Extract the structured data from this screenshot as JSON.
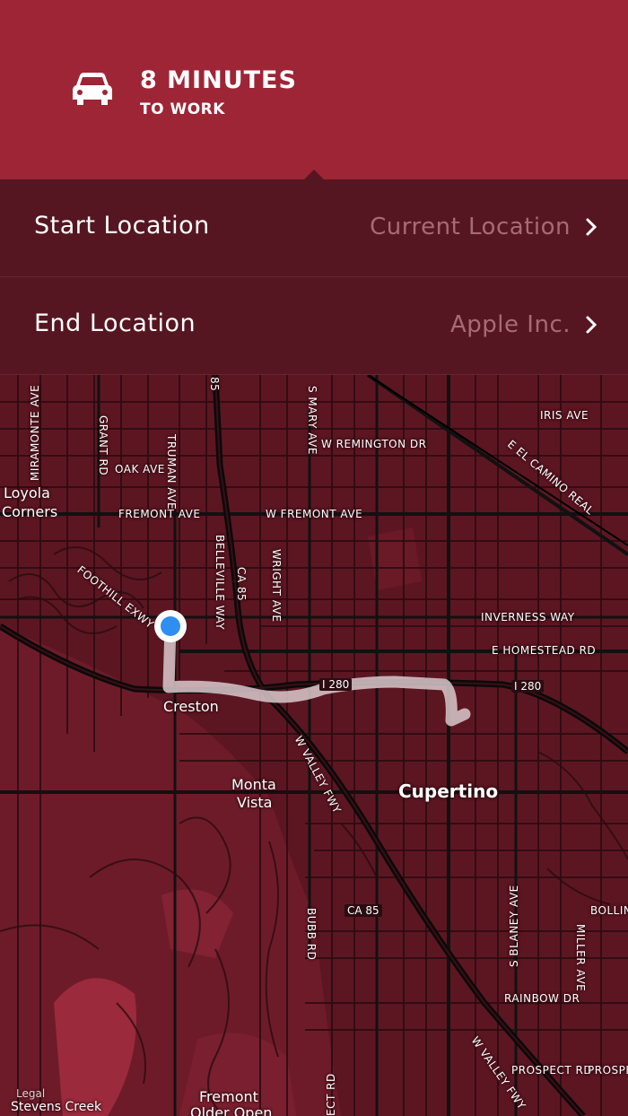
{
  "header": {
    "eta": "8 MINUTES",
    "subtitle": "TO WORK"
  },
  "rows": [
    {
      "label": "Start Location",
      "value": "Current Location"
    },
    {
      "label": "End Location",
      "value": "Apple Inc."
    }
  ],
  "map": {
    "labels": {
      "iris": "IRIS AVE",
      "remington": "W REMINGTON DR",
      "oak": "OAK AVE",
      "fremont": "FREMONT AVE",
      "wfremont": "W FREMONT AVE",
      "inverness": "INVERNESS WAY",
      "homestead": "E HOMESTEAD RD",
      "rainbow": "RAINBOW DR",
      "prospect": "PROSPECT RD",
      "prospect2": "PROSPE",
      "bollin": "BOLLIN",
      "miramonte": "MIRAMONTE AVE",
      "grant": "GRANT RD",
      "truman": "TRUMAN AVE",
      "mary": "S MARY AVE",
      "belleville": "BELLEVILLE WAY",
      "wright": "WRIGHT AVE",
      "ca85vert": "CA 85",
      "ca85top": "85",
      "bubb": "BUBB RD",
      "blaney": "S BLANEY AVE",
      "miller": "MILLER AVE",
      "foothill": "FOOTHILL EXWY",
      "camino": "E EL CAMINO REAL",
      "valley": "W VALLEY FWY",
      "valley2": "W VALLEY FWY",
      "ect": "ECT RD",
      "i280a": "I 280",
      "i280b": "I 280",
      "ca85": "CA 85",
      "loyola1": "Loyola",
      "loyola2": "Corners",
      "creston": "Creston",
      "monta1": "Monta",
      "monta2": "Vista",
      "cupertino": "Cupertino",
      "fremont_older1": "Fremont",
      "fremont_older2": "Older Open",
      "stevens": "Stevens Creek",
      "legal": "Legal"
    }
  },
  "colors": {
    "header": "#9e2536",
    "rows": "#561621",
    "map_bg": "#5c1622",
    "route": "#d9c9cc",
    "location_dot": "#2f8ff0"
  }
}
